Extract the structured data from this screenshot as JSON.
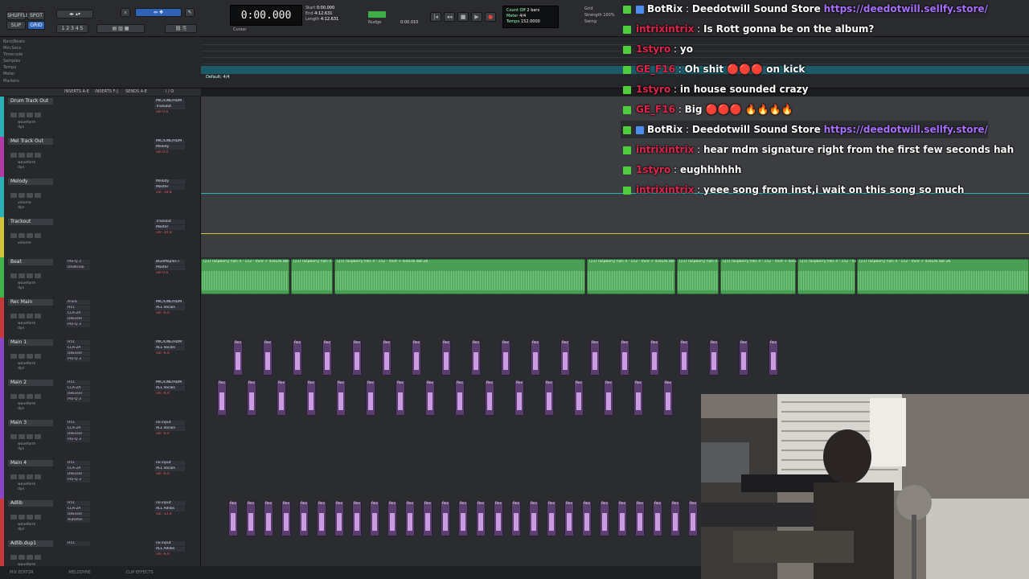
{
  "toolbar": {
    "mode_buttons": [
      "SHUFFLE",
      "SPOT",
      "SLIP",
      "GRID"
    ],
    "counter_value": "0:00.000",
    "counter_label": "Cursor",
    "start_label": "Start",
    "end_label": "End",
    "length_label": "Length",
    "start_value": "0:00.000",
    "end_value": "4:12.631",
    "length_value": "4:12.631",
    "nudge_label": "Nudge",
    "nudge_value": "0:00.010",
    "tempo_labels": [
      "Count Off",
      "Meter",
      "Tempo"
    ],
    "tempo_values": [
      "2 bars",
      "4/4",
      "152.0000"
    ],
    "grid_label": "Grid",
    "strength_label": "Strength",
    "strength_value": "100%",
    "swing_label": "Swing"
  },
  "rulers": {
    "labels": [
      "Bars|Beats",
      "Min:Secs",
      "Timecode",
      "Samples",
      "Tempo",
      "Meter",
      "Markers"
    ],
    "default_meter": "Default: 4/4"
  },
  "track_headers": [
    "INSERTS A-E",
    "INSERTS F-J",
    "SENDS A-E",
    "I / O"
  ],
  "tracks": [
    {
      "name": "Drum Track Out",
      "color": "#2ab0b5",
      "sub": [
        "waveform",
        "dyn"
      ],
      "inserts": [],
      "io": [
        "MIC/LINE/HDM",
        "Trackout"
      ],
      "vol": "vol 0.0"
    },
    {
      "name": "Mel Track Out",
      "color": "#b43aa8",
      "sub": [
        "waveform",
        "dyn"
      ],
      "inserts": [],
      "io": [
        "MIC/LINE/HDM",
        "Melody"
      ],
      "vol": "vol 0.0"
    },
    {
      "name": "Melody",
      "color": "#2ab0b5",
      "sub": [
        "volume",
        "dyn"
      ],
      "inserts": [],
      "io": [
        "Melody",
        "Master"
      ],
      "vol": "vol -10.8"
    },
    {
      "name": "Trackout",
      "color": "#d1c53a",
      "sub": [
        "volume"
      ],
      "inserts": [],
      "io": [
        "Trackout",
        "Master"
      ],
      "vol": "vol -10.8"
    },
    {
      "name": "Beat",
      "color": "#3fb34a",
      "sub": [
        "waveform",
        "dyn"
      ],
      "inserts": [
        "Pro-Q 3",
        "OneKnob"
      ],
      "io": [
        "BlueMaples F",
        "Master"
      ],
      "vol": "vol 0.0"
    },
    {
      "name": "Rec Main",
      "color": "#c93838",
      "sub": [
        "waveform",
        "dyn"
      ],
      "inserts": [
        "ATEIs",
        "H51",
        "CLA-2A",
        "DeEsser",
        "Pro-Q 3"
      ],
      "io": [
        "MIC/LINE/HDM",
        "ALL Vocals"
      ],
      "vol": "vol -6.0"
    },
    {
      "name": "Main 1",
      "color": "#8a44c8",
      "sub": [
        "waveform",
        "dyn"
      ],
      "inserts": [
        "H51",
        "CLA-2A",
        "DeEsser",
        "Pro-Q 3"
      ],
      "io": [
        "MIC/LINE/HDM",
        "ALL Vocals"
      ],
      "vol": "vol -6.0"
    },
    {
      "name": "Main 2",
      "color": "#8a44c8",
      "sub": [
        "waveform",
        "dyn"
      ],
      "inserts": [
        "H51",
        "CLA-2A",
        "DeEsser",
        "Pro-Q 3"
      ],
      "io": [
        "MIC/LINE/HDM",
        "ALL Vocals"
      ],
      "vol": "vol -6.0"
    },
    {
      "name": "Main 3",
      "color": "#8a44c8",
      "sub": [
        "waveform",
        "dyn"
      ],
      "inserts": [
        "H51",
        "CLA-2A",
        "DeEsser",
        "Pro-Q 3"
      ],
      "io": [
        "no input",
        "ALL Vocals"
      ],
      "vol": "vol -6.0"
    },
    {
      "name": "Main 4",
      "color": "#8a44c8",
      "sub": [
        "waveform",
        "dyn"
      ],
      "inserts": [
        "H51",
        "CLA-2A",
        "DeEsser",
        "Pro-Q 3"
      ],
      "io": [
        "no input",
        "ALL Vocals"
      ],
      "vol": "vol -6.0"
    },
    {
      "name": "Adlib",
      "color": "#c93838",
      "sub": [
        "waveform",
        "dyn"
      ],
      "inserts": [
        "H51",
        "CLA-2A",
        "DeEsser",
        "AutoPan"
      ],
      "io": [
        "no input",
        "ALL Adlibs"
      ],
      "vol": "vol -13.6"
    },
    {
      "name": "Adlib.dup1",
      "color": "#c93838",
      "sub": [
        "waveform"
      ],
      "inserts": [
        "H51"
      ],
      "io": [
        "no input",
        "ALL Adlibs"
      ],
      "vol": "vol -6.0"
    }
  ],
  "beat_clip_title": "(21) raspberry hills 4 - 152 - mint + disturb.dot-26",
  "vocal_clip_label": "Rec",
  "bottom_bar": [
    "MIX EDITOR",
    "MELODYNE",
    "CLIP EFFECTS"
  ],
  "chat": [
    {
      "user": "BotRix",
      "user_color": "#ffffff",
      "msg": "Deedotwill Sound Store",
      "link": "https://deedotwill.sellfy.store/"
    },
    {
      "user": "intrixintrix",
      "user_color": "#e0244a",
      "msg": "Is Rott gonna be on the album?",
      "link": ""
    },
    {
      "user": "1styro",
      "user_color": "#e0244a",
      "msg": "yo",
      "link": ""
    },
    {
      "user": "GE_F16",
      "user_color": "#e0244a",
      "msg": "Oh shit 🔴🔴🔴 on kick",
      "link": ""
    },
    {
      "user": "1styro",
      "user_color": "#e0244a",
      "msg": "in house sounded crazy",
      "link": ""
    },
    {
      "user": "GE_F16",
      "user_color": "#e0244a",
      "msg": "Big 🔴🔴🔴 🔥🔥🔥🔥",
      "link": ""
    },
    {
      "user": "BotRix",
      "user_color": "#ffffff",
      "msg": "Deedotwill Sound Store",
      "link": "https://deedotwill.sellfy.store/"
    },
    {
      "user": "intrixintrix",
      "user_color": "#e0244a",
      "msg": "hear mdm signature right from the first few seconds hah",
      "link": ""
    },
    {
      "user": "1styro",
      "user_color": "#e0244a",
      "msg": "eughhhhhh",
      "link": ""
    },
    {
      "user": "intrixintrix",
      "user_color": "#e0244a",
      "msg": "yeee song from inst,i wait on this song so much",
      "link": ""
    }
  ]
}
